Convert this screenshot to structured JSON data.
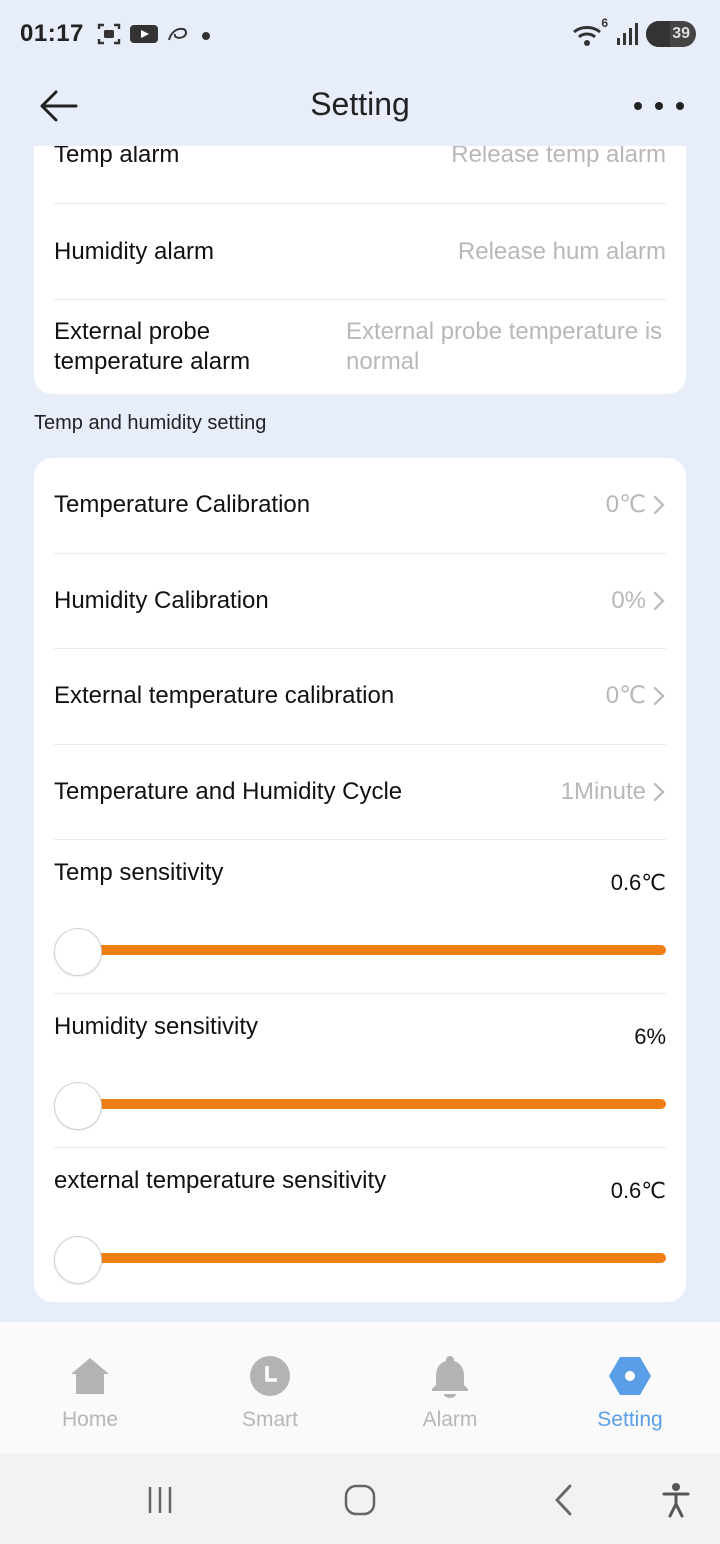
{
  "status_bar": {
    "time": "01:17",
    "wifi_badge": "6",
    "battery": "39"
  },
  "header": {
    "title": "Setting"
  },
  "alarm_rows": [
    {
      "label": "Temp alarm",
      "value": "Release temp alarm"
    },
    {
      "label": "Humidity alarm",
      "value": "Release hum alarm"
    },
    {
      "label": "External probe temperature alarm",
      "value": "External probe temperature is normal"
    }
  ],
  "section": {
    "title": "Temp and humidity setting"
  },
  "settings_rows": [
    {
      "label": "Temperature Calibration",
      "value": "0℃"
    },
    {
      "label": "Humidity Calibration",
      "value": "0%"
    },
    {
      "label": "External temperature calibration",
      "value": "0℃"
    },
    {
      "label": "Temperature and Humidity Cycle",
      "value": "1Minute"
    }
  ],
  "sliders": [
    {
      "label": "Temp sensitivity",
      "value": "0.6℃",
      "level": 0
    },
    {
      "label": "Humidity sensitivity",
      "value": "6%",
      "level": 0
    },
    {
      "label": "external temperature sensitivity",
      "value": "0.6℃",
      "level": 0
    }
  ],
  "tabs": [
    {
      "label": "Home",
      "icon": "home-icon"
    },
    {
      "label": "Smart",
      "icon": "clock-icon"
    },
    {
      "label": "Alarm",
      "icon": "bell-icon"
    },
    {
      "label": "Setting",
      "icon": "gear-hexagon-icon"
    }
  ],
  "colors": {
    "accent": "#f07e12",
    "active_tab": "#5a9ee8",
    "background": "#e7eef9"
  }
}
